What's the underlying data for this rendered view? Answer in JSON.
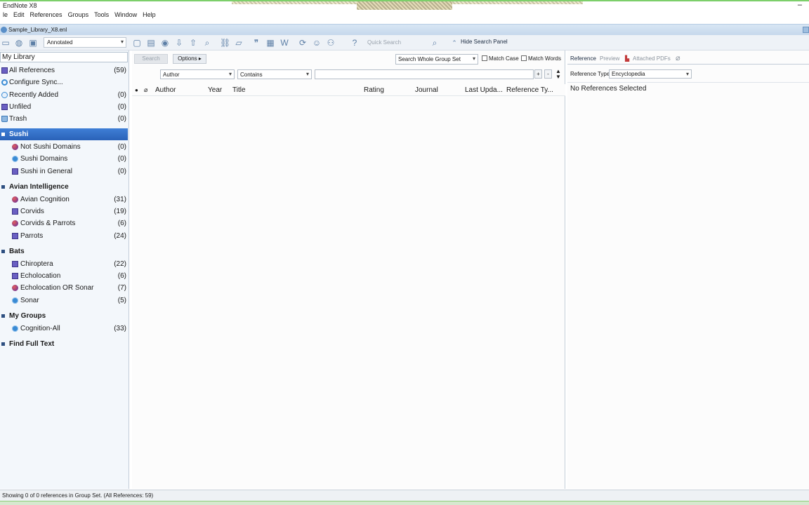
{
  "window": {
    "title": "EndNote X8",
    "minimize": "–"
  },
  "menu": [
    "le",
    "Edit",
    "References",
    "Groups",
    "Tools",
    "Window",
    "Help"
  ],
  "document_tab": {
    "name": "Sample_Library_X8.enl"
  },
  "toolbar": {
    "style": "Annotated",
    "quick_search_placeholder": "Quick Search",
    "hide_search_panel": "Hide Search Panel"
  },
  "left_panel": {
    "library_label": "My Library",
    "items": [
      {
        "label": "All References",
        "count": "(59)"
      },
      {
        "label": "Configure Sync...",
        "count": ""
      },
      {
        "label": "Recently Added",
        "count": "(0)"
      },
      {
        "label": "Unfiled",
        "count": "(0)"
      },
      {
        "label": "Trash",
        "count": "(0)"
      }
    ],
    "groups": [
      {
        "header": "Sushi",
        "children": [
          {
            "label": "Not Sushi Domains",
            "count": "(0)"
          },
          {
            "label": "Sushi Domains",
            "count": "(0)"
          },
          {
            "label": "Sushi in General",
            "count": "(0)"
          }
        ]
      },
      {
        "header": "Avian Intelligence",
        "children": [
          {
            "label": "Avian Cognition",
            "count": "(31)"
          },
          {
            "label": "Corvids",
            "count": "(19)"
          },
          {
            "label": "Corvids & Parrots",
            "count": "(6)"
          },
          {
            "label": "Parrots",
            "count": "(24)"
          }
        ]
      },
      {
        "header": "Bats",
        "children": [
          {
            "label": "Chiroptera",
            "count": "(22)"
          },
          {
            "label": "Echolocation",
            "count": "(6)"
          },
          {
            "label": "Echolocation OR Sonar",
            "count": "(7)"
          },
          {
            "label": "Sonar",
            "count": "(5)"
          }
        ]
      },
      {
        "header": "My Groups",
        "children": [
          {
            "label": "Cognition-All",
            "count": "(33)"
          }
        ]
      },
      {
        "header": "Find Full Text",
        "children": []
      }
    ]
  },
  "search_panel": {
    "search_button": "Search",
    "options_button": "Options",
    "scope": "Search Whole Group Set",
    "match_case": "Match Case",
    "match_words": "Match Words",
    "field": "Author",
    "operator": "Contains",
    "plus": "+",
    "minus": "-"
  },
  "columns": [
    "Author",
    "Year",
    "Title",
    "Rating",
    "Journal",
    "Last Upda...",
    "Reference Ty..."
  ],
  "right_panel": {
    "tabs": [
      "Reference",
      "Preview",
      "Attached PDFs"
    ],
    "reference_type_label": "Reference Type:",
    "reference_type_value": "Encyclopedia",
    "empty_message": "No References Selected"
  },
  "status_bar": "Showing 0 of 0 references in Group Set. (All References: 59)"
}
